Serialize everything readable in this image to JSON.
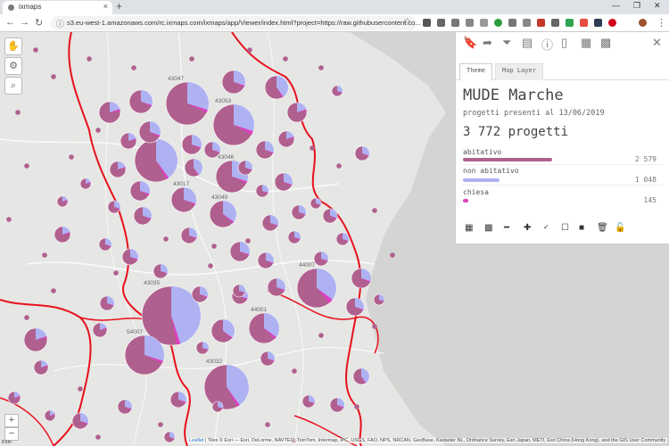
{
  "browser": {
    "tab_title": "ixmaps",
    "new_tab": "+",
    "url": "s3.eu-west-1.amazonaws.com/rc.ixmaps.com/ixmaps/app/Viewer/index.html?project=https://raw.githubusercontent.co...",
    "win_min": "—",
    "win_max": "❐",
    "win_close": "✕"
  },
  "panel": {
    "tabs": [
      "Theme",
      "Map Layer"
    ],
    "title": "MUDE Marche",
    "subtitle": "progetti presenti al 13/06/2019",
    "total": "3 772 progetti",
    "categories": [
      {
        "label": "abitativo",
        "value": "2 579",
        "color": "#b0608e",
        "fraction": 1.0
      },
      {
        "label": "non abitativo",
        "value": "1 048",
        "color": "#aeb2f2",
        "fraction": 0.41
      },
      {
        "label": "chiesa",
        "value": "145",
        "color": "#e040c0",
        "fraction": 0.06
      }
    ],
    "close": "✕"
  },
  "map": {
    "zoom_in": "+",
    "zoom_out": "−",
    "scale": "8 km",
    "attribution_link": "Leaflet",
    "attribution": " | Tiles © Esri — Esri, DeLorme, NAVTEQ, TomTom, Intermap, iPC, USGS, FAO, NPS, NRCAN, GeoBase, Kadaster NL, Ordnance Survey, Esri Japan, METI, Esri China (Hong Kong), and the GIS User Community",
    "labels": [
      "43047",
      "43053",
      "43046",
      "44007",
      "43035",
      "54007",
      "43032",
      "44001",
      "43017",
      "43049"
    ]
  },
  "colors": {
    "abitativo": "#b0608e",
    "non_abitativo": "#aeb2f2",
    "chiesa": "#e040c0",
    "border": "#e8101c"
  }
}
